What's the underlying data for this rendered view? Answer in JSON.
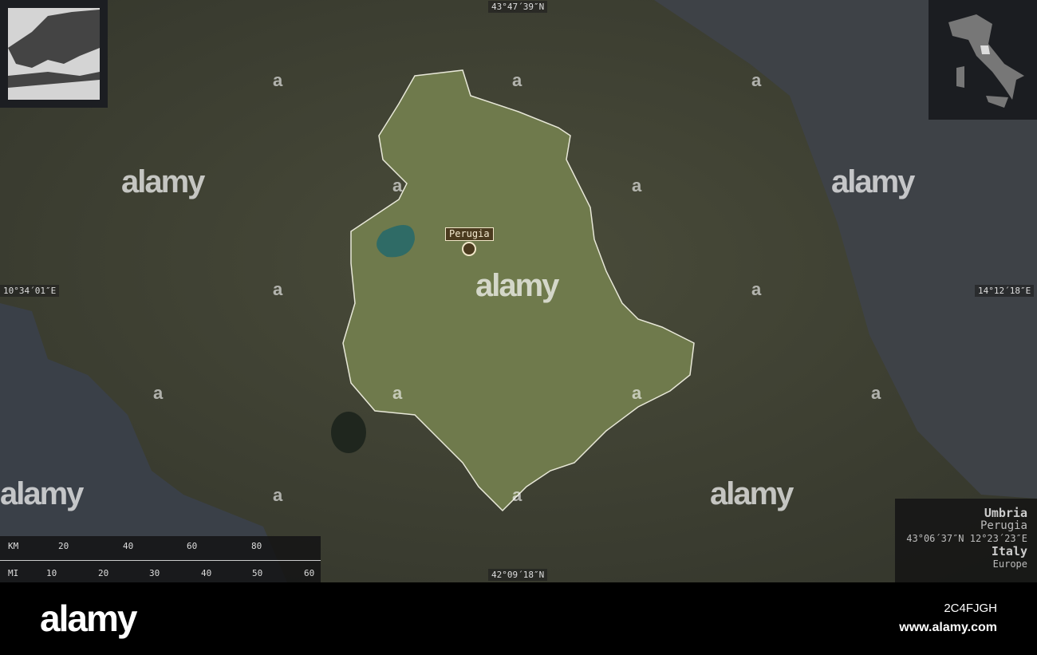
{
  "map": {
    "region": "Umbria",
    "capital": "Perugia",
    "coordinates": "43°06´37″N 12°23´23″E",
    "country": "Italy",
    "continent": "Europe",
    "city_label": "Perugia",
    "frame": {
      "top": "43°47´39″N",
      "bottom": "42°09´18″N",
      "left": "10°34´01″E",
      "right": "14°12´18″E"
    },
    "scale": {
      "km_label": "KM",
      "km_ticks": [
        "20",
        "40",
        "60",
        "80"
      ],
      "mi_label": "MI",
      "mi_ticks": [
        "10",
        "20",
        "30",
        "40",
        "50",
        "60"
      ]
    }
  },
  "watermark": {
    "text": "alamy",
    "letter": "a"
  },
  "footer": {
    "logo": "alamy",
    "image_id": "2C4FJGH",
    "site": "www.alamy.com"
  }
}
